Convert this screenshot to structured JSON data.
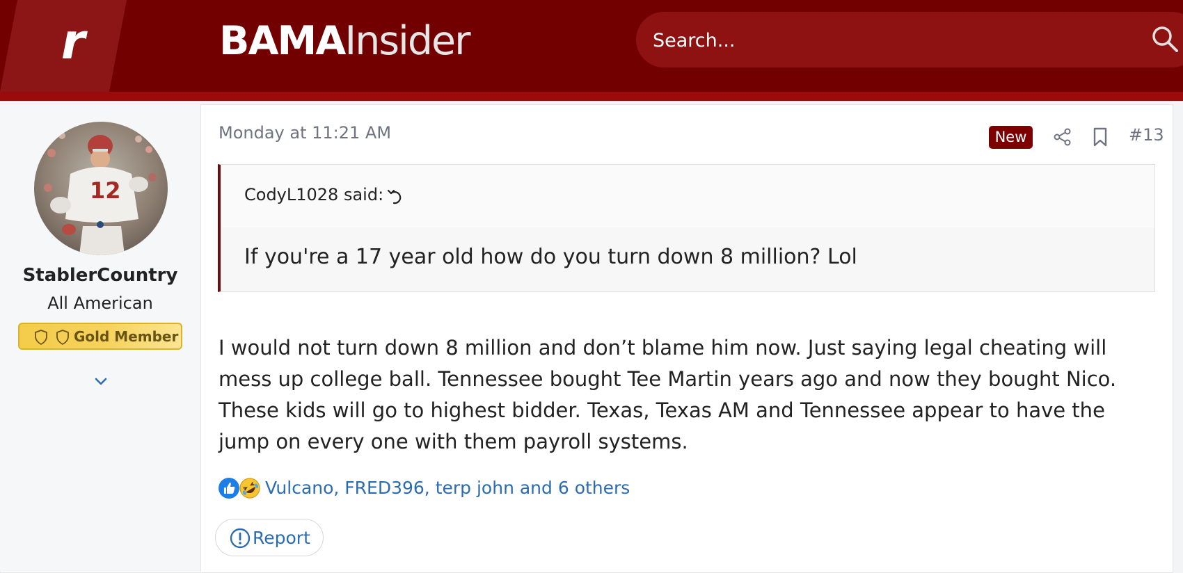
{
  "header": {
    "logo_letter": "r",
    "brand_part1": "BAMA",
    "brand_part2": "Insider",
    "search_placeholder": "Search...",
    "search_icon": "search-icon",
    "colors": {
      "header_bg": "#730000",
      "accent": "#9b0b0b",
      "search_bg": "#8e1212"
    }
  },
  "author": {
    "name": "StablerCountry",
    "title": "All American",
    "badge": "Gold Member",
    "avatar_icon": "avatar-photo",
    "expand_icon": "chevron-down-icon"
  },
  "post": {
    "time": "Monday at 11:21 AM",
    "new_badge": "New",
    "number": "#13",
    "quote": {
      "author": "CodyL1028 said:",
      "text": "If you're a 17 year old how do you turn down 8 million? Lol"
    },
    "body": "I would not turn down 8 million and don’t blame him now. Just saying legal cheating will mess up college ball. Tennessee bought Tee Martin years ago and now they bought Nico. These kids will go to highest bidder. Texas, Texas AM and Tennessee appear to have the jump on every one with them payroll systems.",
    "reactions": {
      "icons": [
        "like-reaction-icon",
        "haha-reaction-icon"
      ],
      "text": "Vulcano, FRED396, terp john and 6 others"
    },
    "report_label": "Report"
  }
}
